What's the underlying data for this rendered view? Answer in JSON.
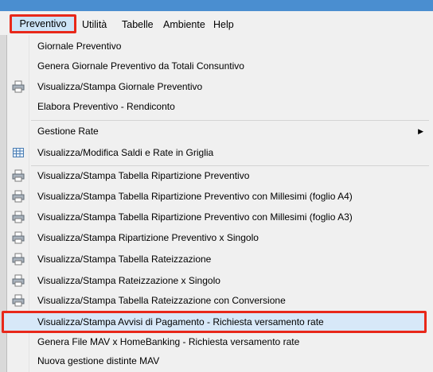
{
  "menubar": {
    "items": [
      "Preventivo",
      "Utilità",
      "Tabelle",
      "Ambiente",
      "Help"
    ]
  },
  "menu": {
    "items": [
      {
        "label": "Giornale Preventivo",
        "icon": "none"
      },
      {
        "label": "Genera Giornale Preventivo da Totali Consuntivo",
        "icon": "none"
      },
      {
        "label": "Visualizza/Stampa Giornale Preventivo",
        "icon": "printer-icon"
      },
      {
        "label": "Elabora Preventivo - Rendiconto",
        "icon": "none"
      },
      {
        "label": "Gestione Rate",
        "icon": "none",
        "submenu": true
      },
      {
        "label": "Visualizza/Modifica Saldi e Rate in Griglia",
        "icon": "grid-icon"
      },
      {
        "label": "Visualizza/Stampa Tabella Ripartizione Preventivo",
        "icon": "printer-icon"
      },
      {
        "label": "Visualizza/Stampa Tabella Ripartizione Preventivo con Millesimi (foglio A4)",
        "icon": "printer-icon"
      },
      {
        "label": "Visualizza/Stampa Tabella Ripartizione Preventivo con Millesimi (foglio A3)",
        "icon": "printer-icon"
      },
      {
        "label": "Visualizza/Stampa Ripartizione Preventivo x Singolo",
        "icon": "printer-icon"
      },
      {
        "label": "Visualizza/Stampa Tabella Rateizzazione",
        "icon": "printer-icon"
      },
      {
        "label": "Visualizza/Stampa Rateizzazione x Singolo",
        "icon": "printer-icon"
      },
      {
        "label": "Visualizza/Stampa Tabella Rateizzazione con Conversione",
        "icon": "printer-icon"
      },
      {
        "label": "Visualizza/Stampa Avvisi di Pagamento - Richiesta versamento rate",
        "icon": "none",
        "highlighted": true
      },
      {
        "label": "Genera File MAV x HomeBanking - Richiesta versamento rate",
        "icon": "none"
      },
      {
        "label": "Nuova gestione distinte MAV",
        "icon": "none"
      }
    ]
  },
  "colors": {
    "highlight_border": "#e8281a",
    "highlight_fill": "#d7e8f8",
    "menu_bg": "#f0f0f0",
    "title_strip": "#4a8ed0"
  }
}
